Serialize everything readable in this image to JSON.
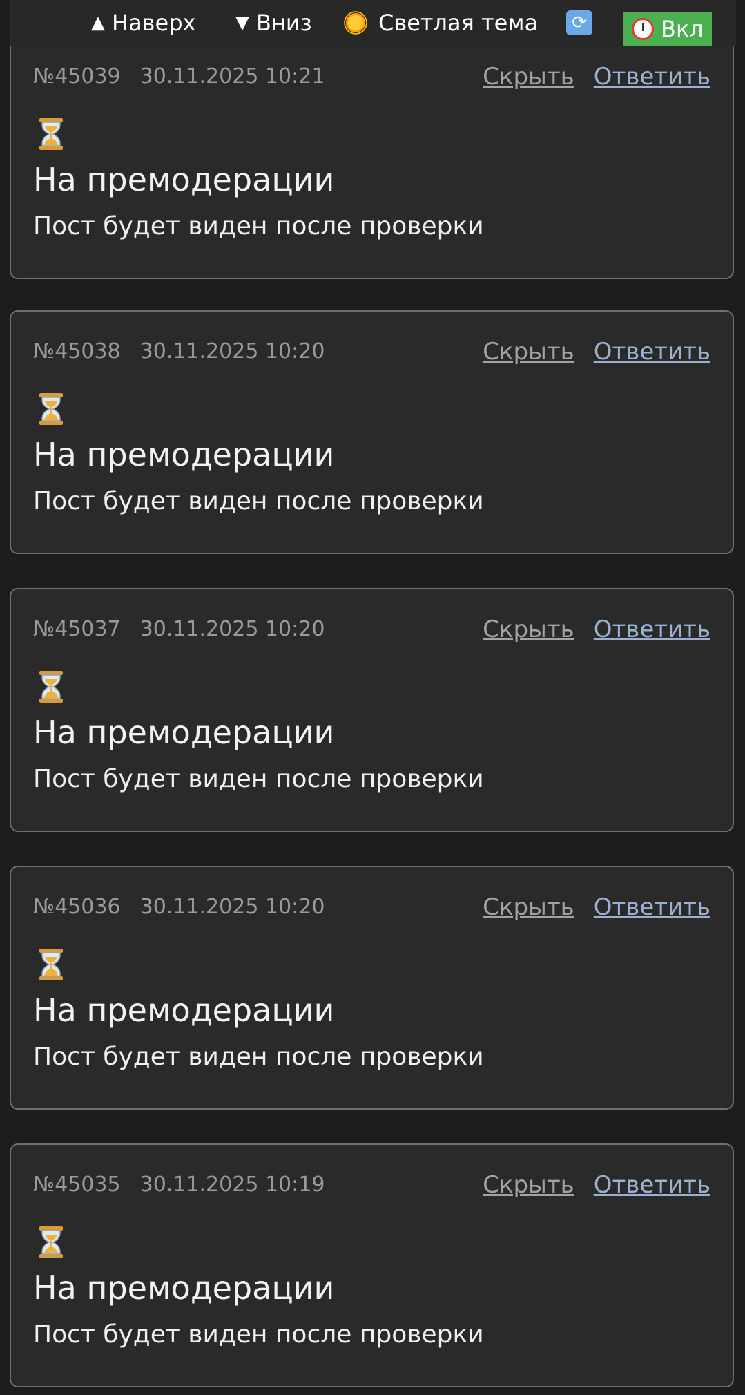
{
  "toolbar": {
    "up_label": "Наверх",
    "down_label": "Вниз",
    "theme_label": "Светлая тема",
    "timer_label": "Вкл",
    "up_glyph": "▲",
    "down_glyph": "▼",
    "refresh_glyph": "⟳",
    "icons": [
      "arrow-up-icon",
      "arrow-down-icon",
      "sun-icon",
      "refresh-icon",
      "alarm-clock-icon"
    ],
    "timer_bg_color": "#4caf50"
  },
  "actions": {
    "hide_label": "Скрыть",
    "reply_label": "Ответить"
  },
  "posts": [
    {
      "number": "№45039",
      "datetime": "30.11.2025 10:21",
      "status_title": "На премодерации",
      "status_text": "Пост будет виден после проверки"
    },
    {
      "number": "№45038",
      "datetime": "30.11.2025 10:20",
      "status_title": "На премодерации",
      "status_text": "Пост будет виден после проверки"
    },
    {
      "number": "№45037",
      "datetime": "30.11.2025 10:20",
      "status_title": "На премодерации",
      "status_text": "Пост будет виден после проверки"
    },
    {
      "number": "№45036",
      "datetime": "30.11.2025 10:20",
      "status_title": "На премодерации",
      "status_text": "Пост будет виден после проверки"
    },
    {
      "number": "№45035",
      "datetime": "30.11.2025 10:19",
      "status_title": "На премодерации",
      "status_text": "Пост будет виден после проверки"
    }
  ]
}
